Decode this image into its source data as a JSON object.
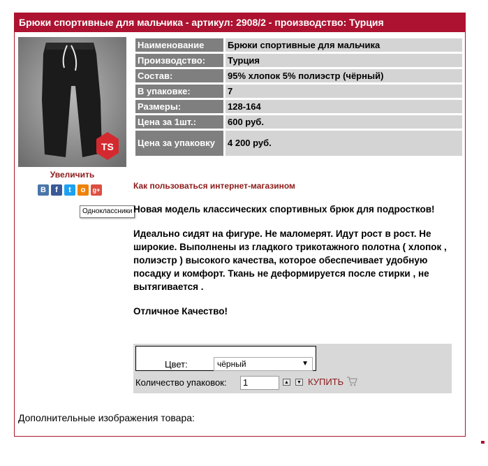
{
  "product": {
    "title": "Брюки спортивные для мальчика - артикул: 2908/2 - производство: Турция",
    "enlarge_label": "Увеличить",
    "image_logo": "TS"
  },
  "social": {
    "icons": [
      {
        "name": "vkontakte-icon",
        "glyph": "B",
        "color": "#4a76a8"
      },
      {
        "name": "facebook-icon",
        "glyph": "f",
        "color": "#3b5998"
      },
      {
        "name": "twitter-icon",
        "glyph": "t",
        "color": "#1da1f2"
      },
      {
        "name": "odnoklassniki-icon",
        "glyph": "о",
        "color": "#ee8208"
      },
      {
        "name": "google-plus-icon",
        "glyph": "g+",
        "color": "#dc4e41"
      }
    ],
    "tooltip": "Одноклассники"
  },
  "specs": [
    {
      "key": "Наименование",
      "value": "Брюки спортивные для мальчика"
    },
    {
      "key": "Производство:",
      "value": "Турция"
    },
    {
      "key": "Состав:",
      "value": "95% хлопок 5% полиэстр (чёрный)"
    },
    {
      "key": "В упаковке:",
      "value": "7"
    },
    {
      "key": "Размеры:",
      "value": "128-164"
    },
    {
      "key": "Цена за 1шт.:",
      "value": "600 руб."
    },
    {
      "key": "Цена за упаковку",
      "value": "4 200 руб."
    }
  ],
  "howto_link": "Как пользоваться интернет-магазином",
  "description": [
    "Новая модель классических спортивных брюк для подростков!",
    "Идеально сидят на фигуре. Не маломерят. Идут рост в рост. Не широкие.  Выполнены из гладкого трикотажного полотна ( хлопок ,  полиэстр ) высокого качества, которое обеспечивает удобную посадку и комфорт. Ткань не деформируется после стирки , не вытягивается .",
    "Отличное Качество!"
  ],
  "order": {
    "color_label": "Цвет:",
    "color_value": "чёрный",
    "qty_label": "Количество упаковок:",
    "qty_value": "1",
    "buy_label": "КУПИТЬ"
  },
  "extra_images_label": "Дополнительные изображения товара:",
  "colors": {
    "accent": "#ad1331",
    "link": "#8d1a1a",
    "spec_key_bg": "#7f7f7f",
    "spec_value_bg": "#d4d4d4"
  }
}
